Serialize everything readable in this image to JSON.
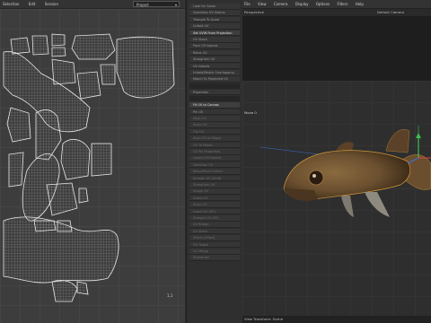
{
  "uv_editor": {
    "menu": [
      "Selection",
      "Edit",
      "Session"
    ],
    "dropdown_value": "Project",
    "corner_label": "1,1"
  },
  "tools_panel": {
    "buttons": [
      "Look for Seam",
      "Seamless UV Seams",
      "Triangle To Quad",
      "Unfold UV",
      "Set UVW From Projection",
      "UV Stack",
      "Pack UV Islands",
      "Relax UV",
      "Straighten UV",
      "UV Islands",
      "Unfold/Match Overlapping",
      "Match To Projected UV",
      "Projection",
      "Fit UV to Canvas",
      "Pin UV",
      "Align UV",
      "Scale UV",
      "Flip UV",
      "Align UV to Edges",
      "UV To Planar",
      "UV Pin Properties",
      "Layout UV Islands",
      "Selection UV",
      "Relax/Move Unfold",
      "Smooth UV (Shift)",
      "Straighten UV",
      "Image UV",
      "Island UV",
      "Scale UV",
      "Island UV (XY)",
      "Straight UV (XY)",
      "UV Bridge",
      "UV Stitch",
      "Stitch (Offset)",
      "UV Target",
      "UV Merge",
      "Straighten"
    ],
    "highlighted": [
      "Set UVW From Projection",
      "Fit UV to Canvas"
    ]
  },
  "viewport": {
    "menu": [
      "File",
      "View",
      "Camera",
      "Display",
      "Options",
      "Filters",
      "Help"
    ],
    "view_label": "Perspective",
    "camera_label": "Default Camera",
    "move_label": "Move",
    "move_value": "0",
    "status": "View Transform: Scene",
    "colors": {
      "fish_body": "#6b5030",
      "axis_x": "#c9473a",
      "axis_y": "#3fbf4b",
      "axis_z": "#3d6fd6"
    }
  }
}
